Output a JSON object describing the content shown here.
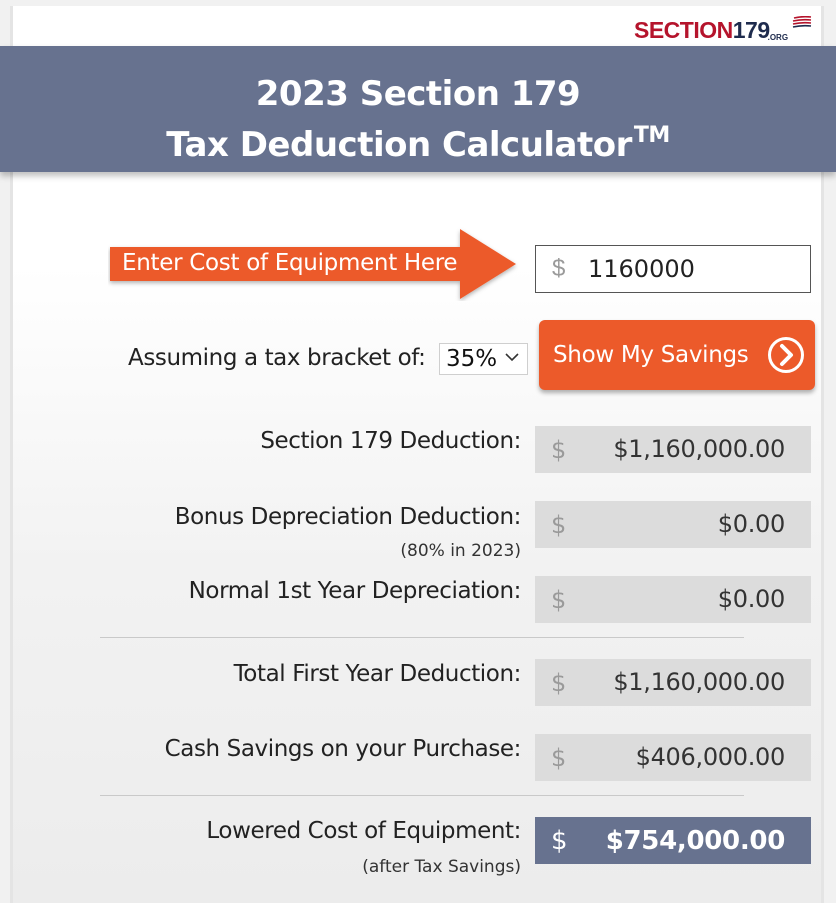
{
  "logo": {
    "brand_a": "SECTION",
    "brand_b": "179",
    "tld": ".ORG"
  },
  "header": {
    "title_line1": "2023 Section 179",
    "title_line2": "Tax Deduction Calculator",
    "trademark": "TM"
  },
  "cost": {
    "arrow_label": "Enter Cost of Equipment Here",
    "currency_symbol": "$",
    "value": "1160000"
  },
  "bracket": {
    "label": "Assuming a tax bracket of:",
    "selected": "35%"
  },
  "action": {
    "button_label": "Show My Savings"
  },
  "results": [
    {
      "label": "Section 179 Deduction:",
      "note": "",
      "currency": "$",
      "value": "$1,160,000.00"
    },
    {
      "label": "Bonus Depreciation Deduction:",
      "note": "(80% in 2023)",
      "currency": "$",
      "value": "$0.00"
    },
    {
      "label": "Normal 1st Year Depreciation:",
      "note": "",
      "currency": "$",
      "value": "$0.00"
    },
    {
      "label": "Total First Year Deduction:",
      "note": "",
      "currency": "$",
      "value": "$1,160,000.00"
    },
    {
      "label": "Cash Savings on your Purchase:",
      "note": "",
      "currency": "$",
      "value": "$406,000.00"
    },
    {
      "label": "Lowered Cost of Equipment:",
      "note": "(after Tax Savings)",
      "currency": "$",
      "value": "$754,000.00"
    }
  ],
  "colors": {
    "header_bg": "#67728f",
    "accent_orange": "#ec5a2a",
    "output_bg": "#dcdcdc",
    "brand_red": "#b5142c",
    "brand_navy": "#1e2b4d"
  },
  "icons": {
    "logo_flag": "flag-stripes-icon",
    "select_chevron": "chevron-down-icon",
    "button_arrow": "circle-arrow-right-icon"
  }
}
